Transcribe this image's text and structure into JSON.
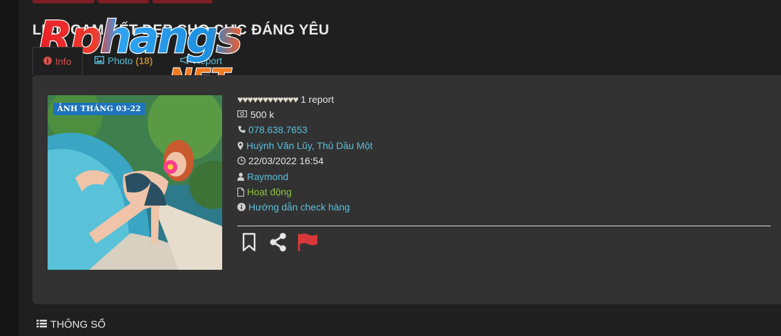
{
  "header": {
    "title": "LIÊN CAM KẾT ĐẸP CHO CỰC ĐÁNG YÊU"
  },
  "watermark": {
    "line1": "Rphangs",
    "line2": ".NET"
  },
  "tabs": [
    {
      "label": "Info",
      "icon": "info-circle-icon",
      "active": true
    },
    {
      "label": "Photo",
      "count": "(18)",
      "icon": "image-icon",
      "active": false
    },
    {
      "label": "Report",
      "icon": "bullhorn-icon",
      "active": false
    }
  ],
  "profile": {
    "photo_badge": "ẢNH THÁNG 03-22",
    "hearts": "♥♥♥♥♥♥♥♥♥♥♥♥",
    "rating": 0,
    "report_count": "1 report",
    "price": "500 k",
    "phone": "078.638.7653",
    "location": "Huỳnh Văn Lũy, Thủ Dầu Một",
    "datetime": "22/03/2022 16:54",
    "author": "Raymond",
    "status": "Hoạt động",
    "guide": "Hướng dẫn check hàng"
  },
  "section": {
    "specs_label": "THÔNG SỐ"
  },
  "colors": {
    "accent_link": "#5bc0de",
    "status_green": "#8cc63f",
    "flag_red": "#d9383a",
    "badge_blue": "#1e73be"
  }
}
